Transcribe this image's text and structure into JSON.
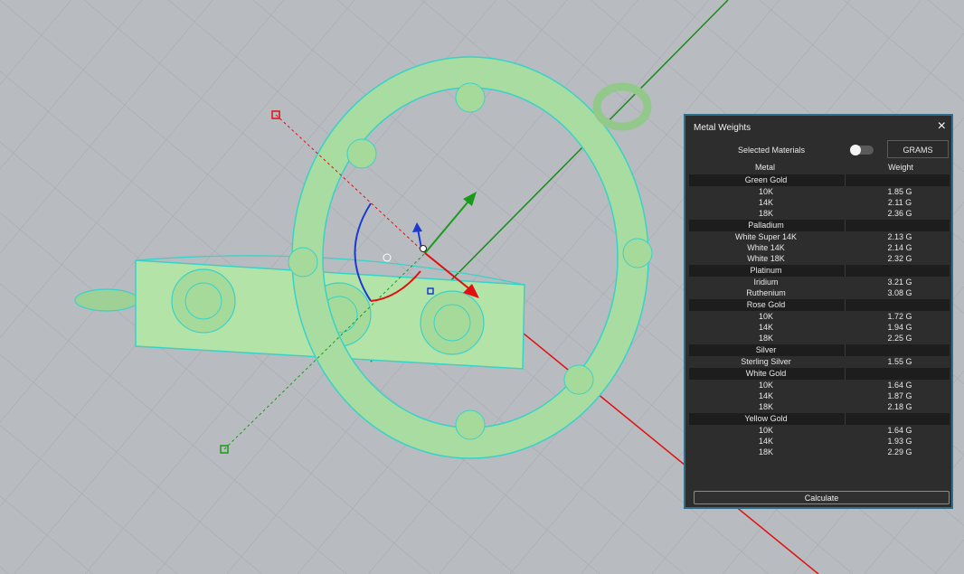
{
  "panel": {
    "title": "Metal Weights",
    "selected_materials_label": "Selected Materials",
    "units_button": "GRAMS",
    "col_metal": "Metal",
    "col_weight": "Weight",
    "calculate_label": "Calculate",
    "close_icon": "×"
  },
  "groups": [
    {
      "name": "Green Gold",
      "rows": [
        {
          "metal": "10K",
          "weight": "1.85 G"
        },
        {
          "metal": "14K",
          "weight": "2.11 G"
        },
        {
          "metal": "18K",
          "weight": "2.36 G"
        }
      ]
    },
    {
      "name": "Palladium",
      "rows": [
        {
          "metal": "White Super 14K",
          "weight": "2.13 G"
        },
        {
          "metal": "White 14K",
          "weight": "2.14 G"
        },
        {
          "metal": "White 18K",
          "weight": "2.32 G"
        }
      ]
    },
    {
      "name": "Platinum",
      "rows": [
        {
          "metal": "Iridium",
          "weight": "3.21 G"
        },
        {
          "metal": "Ruthenium",
          "weight": "3.08 G"
        }
      ]
    },
    {
      "name": "Rose Gold",
      "rows": [
        {
          "metal": "10K",
          "weight": "1.72 G"
        },
        {
          "metal": "14K",
          "weight": "1.94 G"
        },
        {
          "metal": "18K",
          "weight": "2.25 G"
        }
      ]
    },
    {
      "name": "Silver",
      "rows": [
        {
          "metal": "Sterling Silver",
          "weight": "1.55 G"
        }
      ]
    },
    {
      "name": "White Gold",
      "rows": [
        {
          "metal": "10K",
          "weight": "1.64 G"
        },
        {
          "metal": "14K",
          "weight": "1.87 G"
        },
        {
          "metal": "18K",
          "weight": "2.18 G"
        }
      ]
    },
    {
      "name": "Yellow Gold",
      "rows": [
        {
          "metal": "10K",
          "weight": "1.64 G"
        },
        {
          "metal": "14K",
          "weight": "1.93 G"
        },
        {
          "metal": "18K",
          "weight": "2.29 G"
        }
      ]
    }
  ],
  "colors": {
    "viewport_bg": "#b8bcc0",
    "model_fill": "#a8dca0",
    "model_wire": "#37d2c8",
    "axis_x": "#e01010",
    "axis_y": "#1a9a1a",
    "panel_bg": "#2d2d2d",
    "panel_border": "#2e6f8e"
  }
}
